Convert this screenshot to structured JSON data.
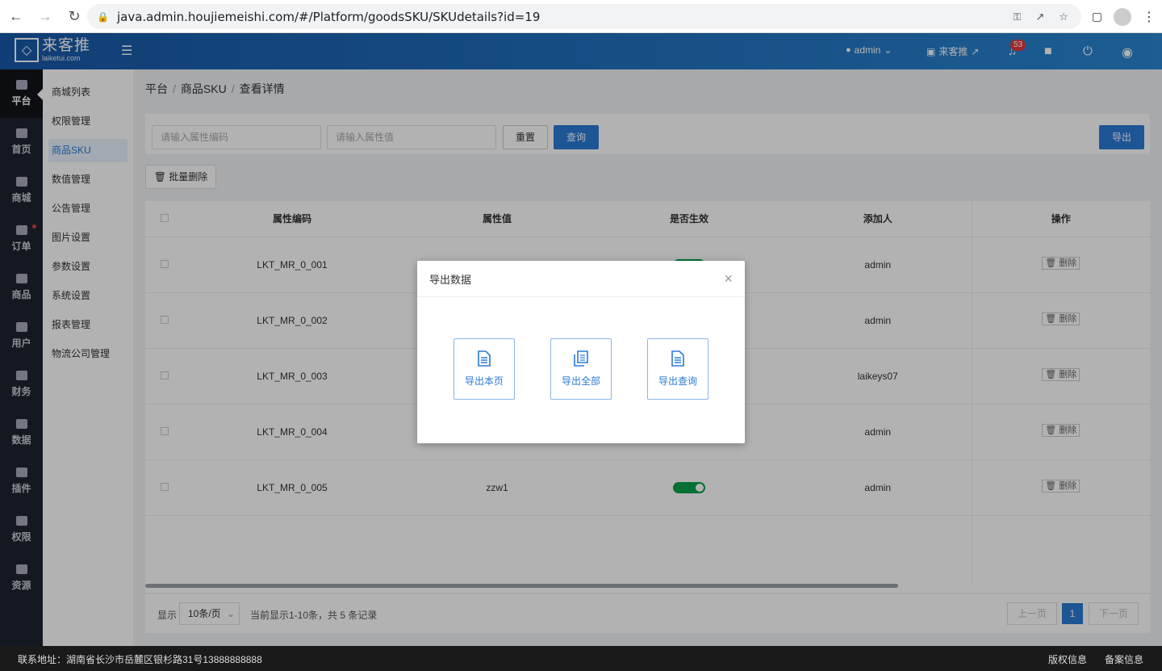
{
  "browser": {
    "url": "java.admin.houjiemeishi.com/#/Platform/goodsSKU/SKUdetails?id=19"
  },
  "header": {
    "logo_cn": "来客推",
    "logo_en": "laiketui.com",
    "user": "admin",
    "store": "来客推",
    "notif_count": "53"
  },
  "rail": [
    {
      "label": "平台",
      "active": true
    },
    {
      "label": "首页"
    },
    {
      "label": "商城"
    },
    {
      "label": "订单"
    },
    {
      "label": "商品"
    },
    {
      "label": "用户"
    },
    {
      "label": "财务"
    },
    {
      "label": "数据"
    },
    {
      "label": "插件"
    },
    {
      "label": "权限"
    },
    {
      "label": "资源"
    }
  ],
  "subnav": [
    {
      "label": "商城列表"
    },
    {
      "label": "权限管理"
    },
    {
      "label": "商品SKU",
      "active": true
    },
    {
      "label": "数值管理"
    },
    {
      "label": "公告管理"
    },
    {
      "label": "图片设置"
    },
    {
      "label": "参数设置"
    },
    {
      "label": "系统设置"
    },
    {
      "label": "报表管理"
    },
    {
      "label": "物流公司管理"
    }
  ],
  "breadcrumb": [
    "平台",
    "商品SKU",
    "查看详情"
  ],
  "filter": {
    "code_placeholder": "请输入属性编码",
    "value_placeholder": "请输入属性值",
    "reset": "重置",
    "query": "查询",
    "export": "导出"
  },
  "toolbar": {
    "batch_delete": "批量删除"
  },
  "table": {
    "headers": [
      "属性编码",
      "属性值",
      "是否生效",
      "添加人",
      "操作"
    ],
    "rows": [
      {
        "code": "LKT_MR_0_001",
        "value": "",
        "adder": "admin"
      },
      {
        "code": "LKT_MR_0_002",
        "value": "",
        "adder": "admin"
      },
      {
        "code": "LKT_MR_0_003",
        "value": "",
        "adder": "laikeys07"
      },
      {
        "code": "LKT_MR_0_004",
        "value": "",
        "adder": "admin"
      },
      {
        "code": "LKT_MR_0_005",
        "value": "zzw1",
        "adder": "admin"
      }
    ],
    "delete_label": "删除"
  },
  "pager": {
    "show": "显示",
    "page_size": "10条/页",
    "summary": "当前显示1-10条，共 5 条记录",
    "prev": "上一页",
    "current": "1",
    "next": "下一页"
  },
  "modal": {
    "title": "导出数据",
    "btn_page": "导出本页",
    "btn_all": "导出全部",
    "btn_query": "导出查询"
  },
  "footer": {
    "address": "联系地址：湖南省长沙市岳麓区银杉路31号13888888888",
    "copyright": "版权信息",
    "icp": "备案信息"
  }
}
